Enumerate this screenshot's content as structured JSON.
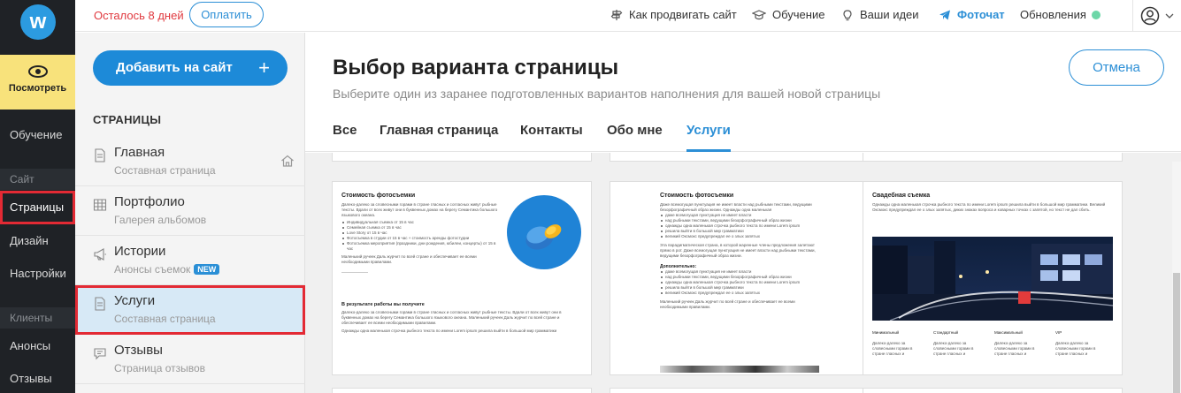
{
  "rail": {
    "logo": "w",
    "view_label": "Посмотреть",
    "learn": "Обучение",
    "section_site": "Сайт",
    "pages": "Страницы",
    "design": "Дизайн",
    "settings": "Настройки",
    "section_clients": "Клиенты",
    "announcements": "Анонсы",
    "reviews": "Отзывы"
  },
  "topbar": {
    "trial": "Осталось 8 дней",
    "pay": "Оплатить",
    "promote": "Как продвигать сайт",
    "learning": "Обучение",
    "ideas": "Ваши идеи",
    "photochat": "Фоточат",
    "updates": "Обновления",
    "updates_dot_color": "#6dd7a8"
  },
  "pages_sidebar": {
    "add_button": "Добавить на сайт",
    "add_plus": "+",
    "heading": "СТРАНИЦЫ",
    "items": [
      {
        "title": "Главная",
        "subtitle": "Составная страница",
        "icon": "page-icon"
      },
      {
        "title": "Портфолио",
        "subtitle": "Галерея альбомов",
        "icon": "grid-icon"
      },
      {
        "title": "Истории",
        "subtitle": "Анонсы съемок",
        "badge": "NEW",
        "icon": "megaphone-icon"
      },
      {
        "title": "Услуги",
        "subtitle": "Составная страница",
        "icon": "page-icon"
      },
      {
        "title": "Отзывы",
        "subtitle": "Страница отзывов",
        "icon": "chat-icon"
      }
    ]
  },
  "main": {
    "title": "Выбор варианта страницы",
    "subtitle": "Выберите один из заранее подготовленных вариантов наполнения для вашей новой страницы",
    "cancel": "Отмена",
    "tabs": [
      "Все",
      "Главная страница",
      "Контакты",
      "Обо мне",
      "Услуги"
    ],
    "active_tab": "Услуги",
    "accent_color": "#2c8fd6"
  },
  "cards": [
    {
      "heading": "Стоимость фотосъемки",
      "intro": "Далеко-далеко за словесными горами в стране гласных и согласных живут рыбные тексты. Вдали от всех живут они в буквенных домах на берегу Семантика большого языкового океана.",
      "bullets": [
        "Индивидуальная съемка от 15 в час",
        "Семейная съемка от 15 в час",
        "Love Story от 15 в час",
        "Фотосъемка в студии от 15 в час + стоимость аренды фотостудии",
        "Фотосъемка мероприятия (праздники, дни рождения, юбилеи, концерты) от 15 в час"
      ],
      "outro": "Маленький ручеек Даль журчит по всей стране и обеспечивает ее всеми необходимыми правилами.",
      "heading2": "В результате работы вы получите",
      "text2": "Далеко-далеко за словесными горами в стране гласных и согласных живут рыбные тексты. Вдали от всех живут они в буквенных домах на берегу Семантика большого языкового океана. Маленький ручеек Даль журчит по всей стране и обеспечивает ее всеми необходимыми правилами.",
      "text3": "Однажды одна маленькая строчка рыбного текста по имени Lorem ipsum решила выйти в большой мир грамматики"
    },
    {
      "heading": "Стоимость фотосъемки",
      "intro": "Даже всемогущая пунктуация не имеет власти над рыбными текстами, ведущими безорфографичный образ жизни. Однажды одна маленькая",
      "bullets": [
        "даже всемогущая пунктуация не имеет власти",
        "над рыбными текстами, ведущими безорфографичный образ жизни",
        "однажды одна маленькая строчка рыбного текста по имени Lorem ipsum",
        "решила выйти в большой мир грамматики",
        "великий Оксмокс предупреждал ее о злых запятых"
      ],
      "mid": "Эта парадигматическая страна, в которой жаренные члены предложения залетают прямо в рот. Даже всемогущая пунктуация не имеет власти над рыбными текстами, ведущими безорфографичный образ жизни.",
      "heading2": "Дополнительно:",
      "bullets2": [
        "даже всемогущая пунктуация не имеет власти",
        "над рыбными текстами, ведущими безорфографичный образ жизни",
        "однажды одна маленькая строчка рыбного текста по имени Lorem ipsum",
        "решила выйти в большой мир грамматики",
        "великий Оксмокс предупреждал ее о злых запятых"
      ],
      "outro": "Маленький ручеек Даль журчит по всей стране и обеспечивает ее всеми необходимыми правилами."
    },
    {
      "heading": "Свадебная съемка",
      "intro": "Однажды одна маленькая строчка рыбного текста по имени Lorem ipsum решила выйти в большой мир грамматики. Великий Оксмокс предупреждал ее о злых запятых, диких знаках вопроса и коварных точках с запятой, но текст не дал сбить.",
      "prices": [
        "Минимальный",
        "Стандартный",
        "Максимальный",
        "VIP"
      ],
      "price_text": "Далеко-далеко за словесными горами в стране гласных и"
    }
  ]
}
